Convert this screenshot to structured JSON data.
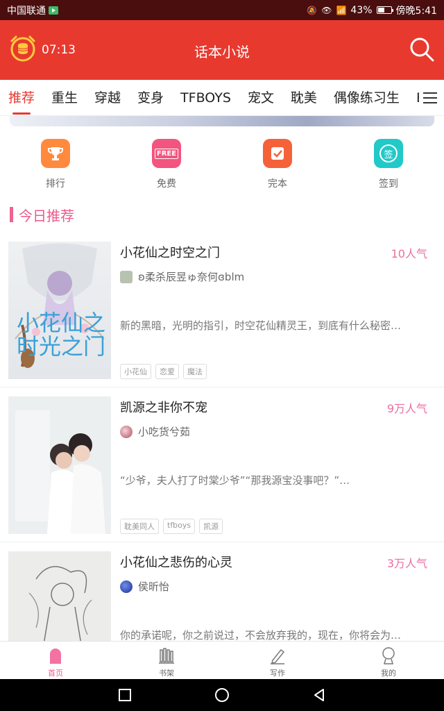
{
  "status_bar": {
    "carrier": "中国联通",
    "battery": "43%",
    "time": "傍晚5:41",
    "battery_level": 0.43
  },
  "app_bar": {
    "time": "07:13",
    "title": "话本小说"
  },
  "tabs": [
    {
      "label": "推荐",
      "active": true
    },
    {
      "label": "重生"
    },
    {
      "label": "穿越"
    },
    {
      "label": "变身"
    },
    {
      "label": "TFBOYS"
    },
    {
      "label": "宠文"
    },
    {
      "label": "耽美"
    },
    {
      "label": "偶像练习生"
    },
    {
      "label": "E"
    }
  ],
  "quick_actions": [
    {
      "label": "排行",
      "icon": "trophy-icon",
      "color": "#ff8a3d"
    },
    {
      "label": "免费",
      "icon": "free-icon",
      "color": "#f2557f",
      "badge": "FREE"
    },
    {
      "label": "完本",
      "icon": "check-icon",
      "color": "#f5623a"
    },
    {
      "label": "签到",
      "icon": "sign-in-icon",
      "color": "#21c9c9",
      "badge": "签"
    }
  ],
  "section": {
    "title": "今日推荐"
  },
  "books": [
    {
      "title": "小花仙之时空之门",
      "popularity": "10人气",
      "author": "ʚ柔杀辰昱ゅ奈何ɞblm",
      "description": "新的黑暗，光明的指引，时空花仙精灵王，到底有什么秘密…",
      "tags": [
        "小花仙",
        "恋爱",
        "魔法"
      ],
      "cover_text": "小花仙之时光之门"
    },
    {
      "title": "凯源之非你不宠",
      "popularity": "9万人气",
      "author": "小吃货兮茹",
      "description": "“少爷，夫人打了时棠少爷”“那我源宝没事吧？”…",
      "tags": [
        "耽美同人",
        "tfboys",
        "凯源"
      ]
    },
    {
      "title": "小花仙之悲伤的心灵",
      "popularity": "3万人气",
      "author": "侯昕怡",
      "description": "你的承诺呢，你之前说过，不会放弃我的，现在，你将会为…",
      "tags": []
    }
  ],
  "bottom_nav": [
    {
      "label": "首页",
      "icon": "home-icon",
      "active": true
    },
    {
      "label": "书架",
      "icon": "bookshelf-icon"
    },
    {
      "label": "写作",
      "icon": "pen-icon"
    },
    {
      "label": "我的",
      "icon": "profile-icon"
    }
  ],
  "colors": {
    "primary_red": "#e8392f",
    "accent_pink": "#ec5a8c"
  }
}
